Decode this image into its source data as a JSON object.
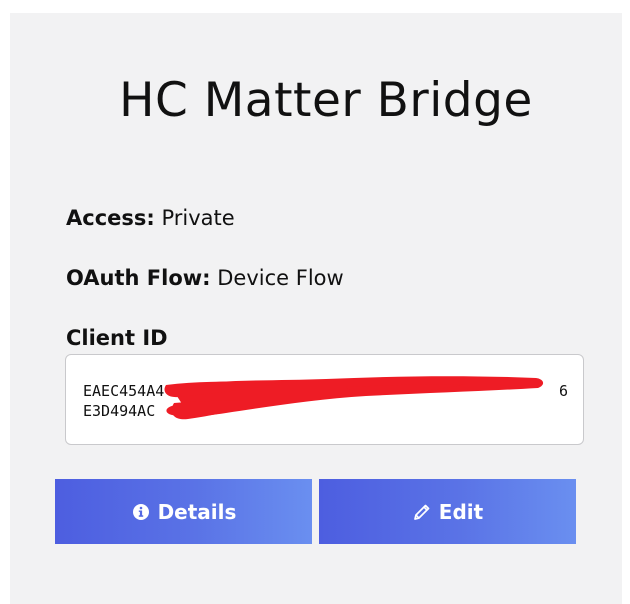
{
  "app": {
    "title": "HC Matter Bridge"
  },
  "fields": {
    "access_label": "Access:",
    "access_value": "Private",
    "oauth_label": "OAuth Flow:",
    "oauth_value": "Device Flow"
  },
  "client": {
    "label": "Client ID",
    "value_line1_start": "EAEC454A4",
    "value_line1_end": "6",
    "value_line2_start": "E3D494AC"
  },
  "buttons": {
    "details_label": "Details",
    "details_icon": "info-circle-icon",
    "edit_label": "Edit",
    "edit_icon": "pencil-icon"
  },
  "colors": {
    "button_start": "#4d5ee0",
    "button_end": "#6a8ff0",
    "redaction": "#ee1c25",
    "card_background": "#f2f2f3"
  }
}
